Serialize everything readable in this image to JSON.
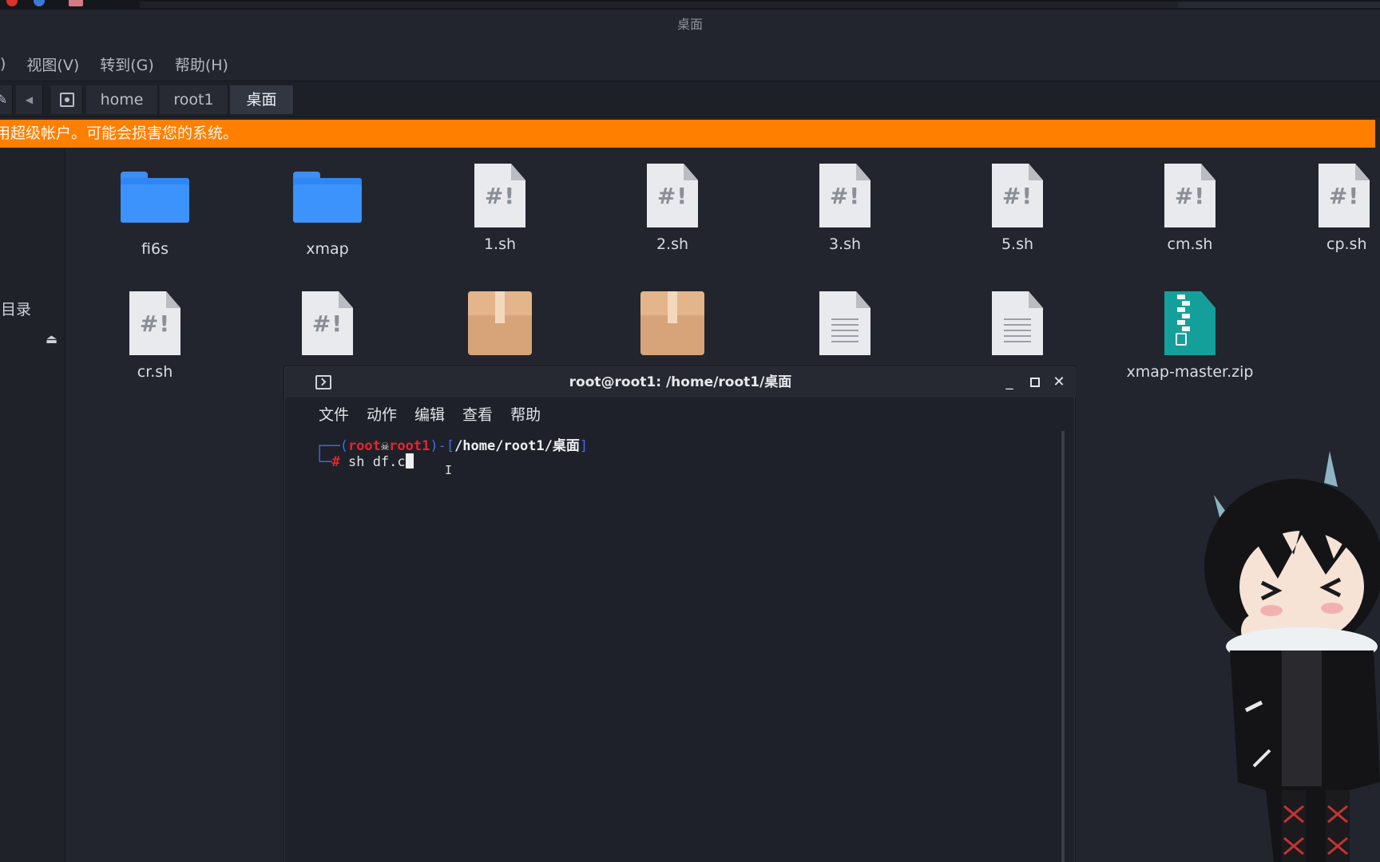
{
  "file_manager": {
    "title": "桌面",
    "menu": [
      "视图(V)",
      "转到(G)",
      "帮助(H)"
    ],
    "path": [
      "home",
      "root1",
      "桌面"
    ],
    "warning": "用超级帐户。可能会损害您的系统。",
    "sidebar_label": "根目录",
    "items_row1": [
      "fi6s",
      "xmap",
      "1.sh",
      "2.sh",
      "3.sh",
      "5.sh",
      "cm.sh",
      "cp.sh"
    ],
    "items_row2": [
      "cr.sh",
      "",
      "",
      "",
      "",
      "",
      "xmap-master.zip"
    ]
  },
  "terminal": {
    "title": "root@root1: /home/root1/桌面",
    "menu": [
      "文件",
      "动作",
      "编辑",
      "查看",
      "帮助"
    ],
    "prompt_user": "root",
    "prompt_host": "root1",
    "prompt_path": "/home/root1/桌面",
    "command": "sh df.c"
  },
  "colors": {
    "warning_bg": "#ff7f00",
    "folder_blue": "#2f86f5",
    "archive_tan": "#d7a47a",
    "zip_teal": "#159f9a",
    "prompt_red": "#e5252b",
    "prompt_blue": "#3d6df0"
  }
}
